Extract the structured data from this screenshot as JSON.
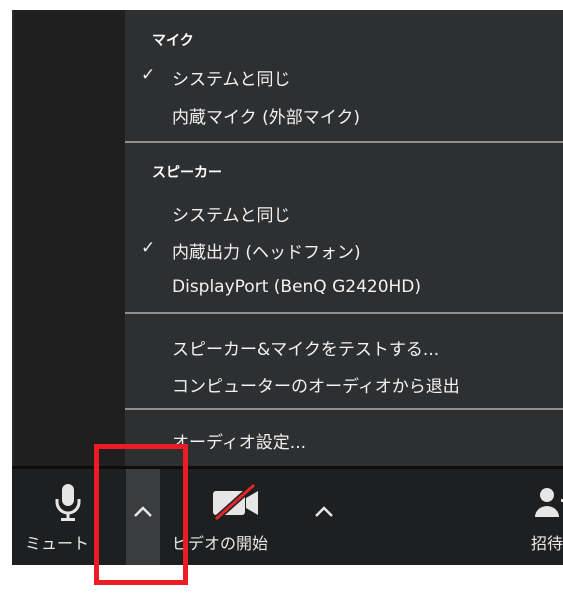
{
  "audio_menu": {
    "mic_header": "マイク",
    "mic_items": [
      {
        "label": "システムと同じ",
        "checked": true
      },
      {
        "label": "内蔵マイク (外部マイク)",
        "checked": false
      }
    ],
    "speaker_header": "スピーカー",
    "speaker_items": [
      {
        "label": "システムと同じ",
        "checked": false
      },
      {
        "label": "内蔵出力 (ヘッドフォン)",
        "checked": true
      },
      {
        "label": "DisplayPort (BenQ G2420HD)",
        "checked": false
      }
    ],
    "actions": [
      {
        "label": "スピーカー&マイクをテストする..."
      },
      {
        "label": "コンピューターのオーディオから退出"
      }
    ],
    "settings_label": "オーディオ設定...",
    "check_glyph": "✓"
  },
  "toolbar": {
    "mute_label": "ミュート",
    "video_label": "ビデオの開始",
    "invite_label": "招待"
  },
  "colors": {
    "menu_bg": "#2e2f31",
    "toolbar_bg": "#1e1f20",
    "highlight": "#ec1c24",
    "video_off_slash": "#e02828"
  }
}
